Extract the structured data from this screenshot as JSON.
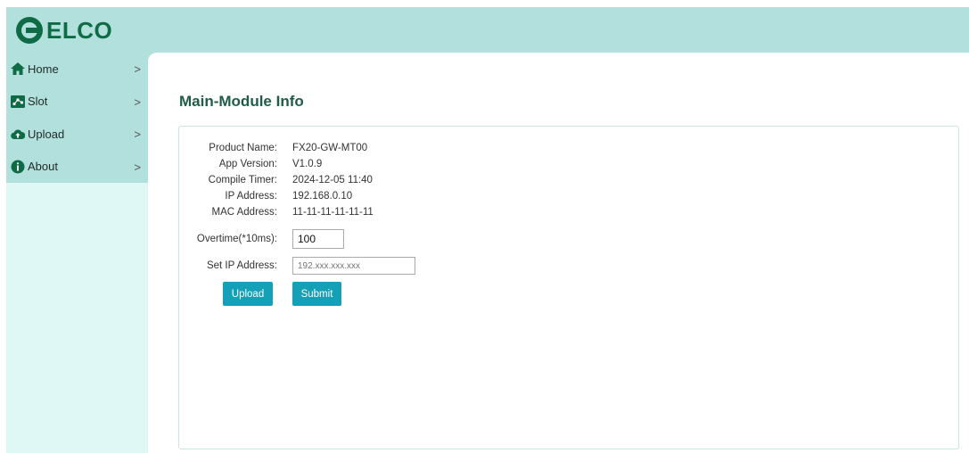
{
  "brand": {
    "name": "ELCO"
  },
  "colors": {
    "header_bg": "#b2e0dc",
    "sidebar_bg": "#dff7f5",
    "brand_green": "#0e6b45",
    "title_green": "#1f5c47",
    "button_teal": "#14a0b6"
  },
  "sidebar": {
    "items": [
      {
        "label": "Home",
        "icon": "home-icon",
        "chevron": ">"
      },
      {
        "label": "Slot",
        "icon": "slot-icon",
        "chevron": ">"
      },
      {
        "label": "Upload",
        "icon": "upload-cloud-icon",
        "chevron": ">"
      },
      {
        "label": "About",
        "icon": "info-icon",
        "chevron": ">"
      }
    ]
  },
  "main": {
    "title": "Main-Module Info",
    "info": [
      {
        "label": "Product Name:",
        "value": "FX20-GW-MT00"
      },
      {
        "label": "App Version:",
        "value": "V1.0.9"
      },
      {
        "label": "Compile Timer:",
        "value": "2024-12-05 11:40"
      },
      {
        "label": "IP Address:",
        "value": "192.168.0.10"
      },
      {
        "label": "MAC Address:",
        "value": "11-11-11-11-11-11"
      }
    ],
    "overtime": {
      "label": "Overtime(*10ms):",
      "value": "100"
    },
    "set_ip": {
      "label": "Set IP Address:",
      "placeholder": "192.xxx.xxx.xxx"
    },
    "buttons": {
      "upload": "Upload",
      "submit": "Submit"
    }
  }
}
